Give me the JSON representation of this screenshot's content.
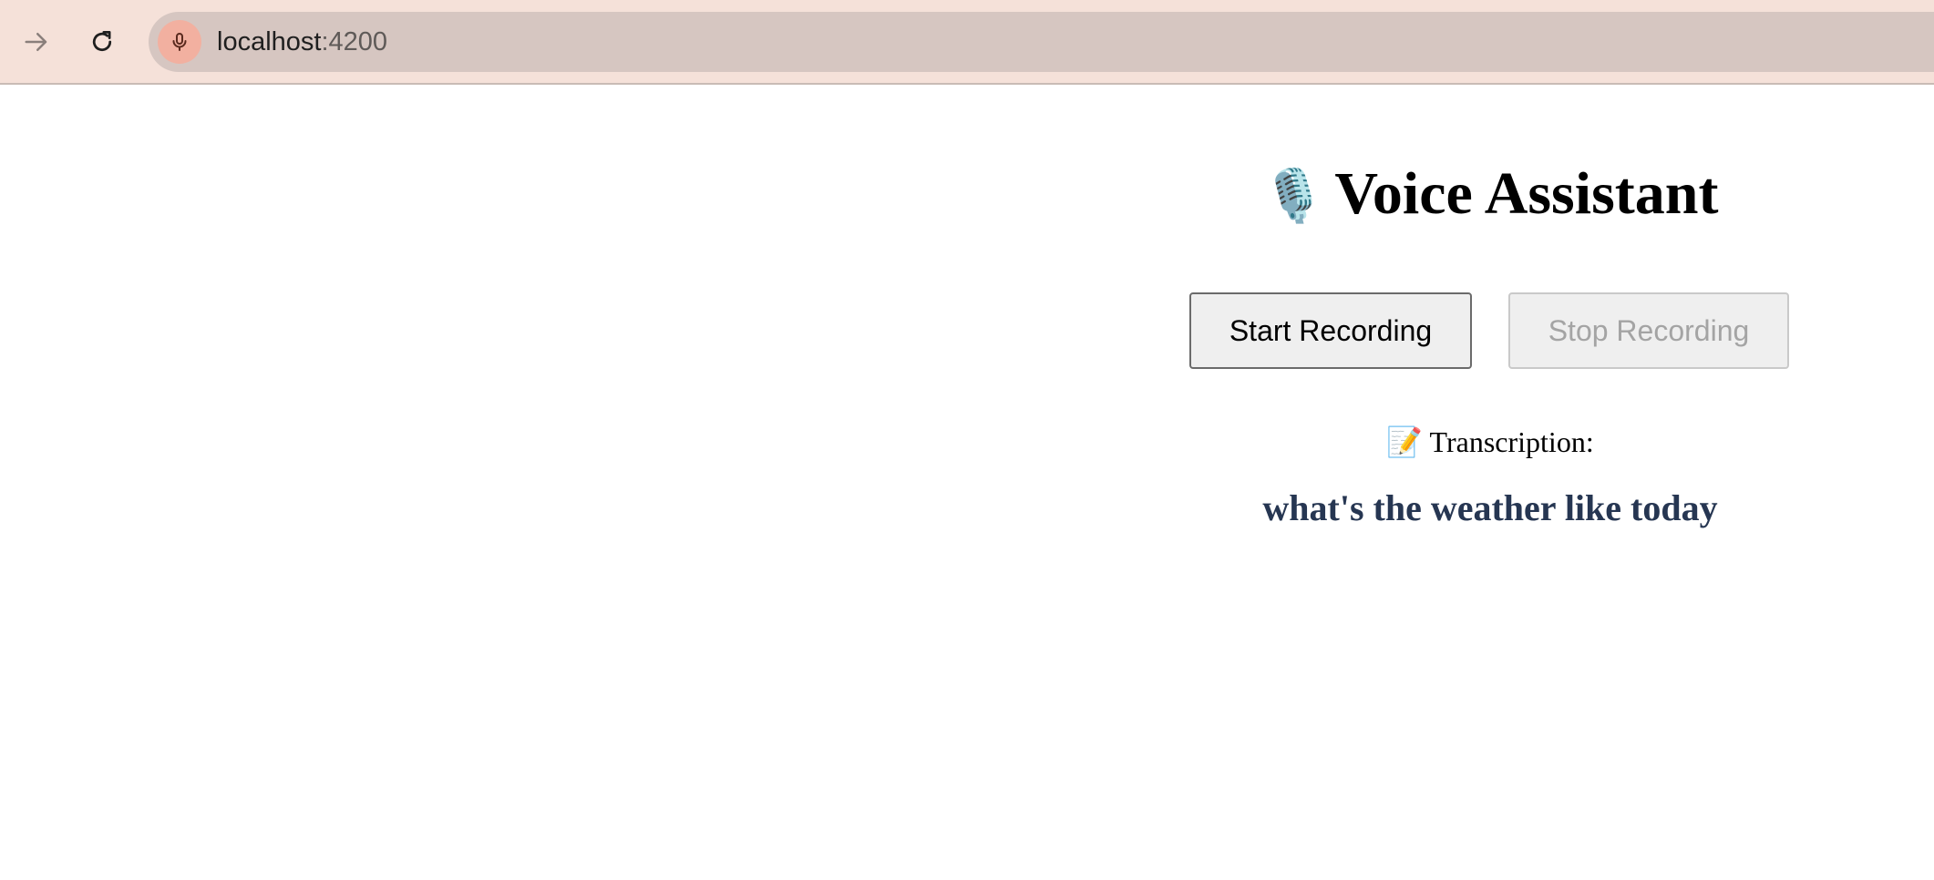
{
  "browser": {
    "url_host": "localhost",
    "url_port": ":4200",
    "forward_icon": "arrow-right-icon",
    "reload_icon": "reload-icon",
    "mic_icon": "microphone-icon",
    "colors": {
      "toolbar_bg": "#f5e1d9",
      "omnibox_bg": "#d6c6c1",
      "mic_indicator_bg": "#f2b0a0"
    }
  },
  "app": {
    "title_emoji": "🎙️",
    "title": "Voice Assistant",
    "start_button_label": "Start Recording",
    "stop_button_label": "Stop Recording",
    "stop_button_disabled": true,
    "transcription_emoji": "📝",
    "transcription_label": "Transcription:",
    "transcription_text": "what's the weather like today",
    "colors": {
      "transcription_text": "#263652"
    }
  }
}
